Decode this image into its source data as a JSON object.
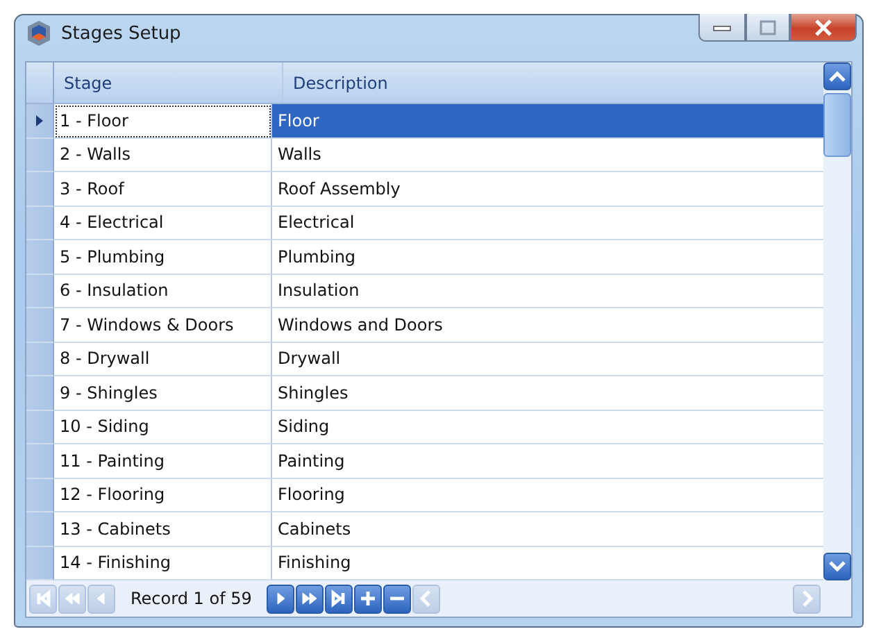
{
  "window": {
    "title": "Stages Setup"
  },
  "grid": {
    "columns": [
      "Stage",
      "Description"
    ],
    "rows": [
      {
        "stage": "1 - Floor",
        "description": "Floor",
        "selected": true
      },
      {
        "stage": "2 - Walls",
        "description": "Walls",
        "selected": false
      },
      {
        "stage": "3 - Roof",
        "description": "Roof Assembly",
        "selected": false
      },
      {
        "stage": "4 - Electrical",
        "description": "Electrical",
        "selected": false
      },
      {
        "stage": "5 - Plumbing",
        "description": "Plumbing",
        "selected": false
      },
      {
        "stage": "6 - Insulation",
        "description": "Insulation",
        "selected": false
      },
      {
        "stage": "7 - Windows & Doors",
        "description": "Windows and Doors",
        "selected": false
      },
      {
        "stage": "8 - Drywall",
        "description": "Drywall",
        "selected": false
      },
      {
        "stage": "9 - Shingles",
        "description": "Shingles",
        "selected": false
      },
      {
        "stage": "10 - Siding",
        "description": "Siding",
        "selected": false
      },
      {
        "stage": "11 - Painting",
        "description": "Painting",
        "selected": false
      },
      {
        "stage": "12 - Flooring",
        "description": "Flooring",
        "selected": false
      },
      {
        "stage": "13 - Cabinets",
        "description": "Cabinets",
        "selected": false
      },
      {
        "stage": "14 - Finishing",
        "description": "Finishing",
        "selected": false
      }
    ]
  },
  "navigator": {
    "record_text": "Record 1 of 59",
    "left_buttons": [
      {
        "kind": "first",
        "disabled": true
      },
      {
        "kind": "prev-page",
        "disabled": true
      },
      {
        "kind": "prev",
        "disabled": true
      }
    ],
    "right_buttons": [
      {
        "kind": "next",
        "disabled": false
      },
      {
        "kind": "next-page",
        "disabled": false
      },
      {
        "kind": "last",
        "disabled": false
      },
      {
        "kind": "add",
        "disabled": false
      },
      {
        "kind": "remove",
        "disabled": false
      },
      {
        "kind": "cancel",
        "disabled": true
      }
    ],
    "end_button": {
      "kind": "end",
      "disabled": true
    }
  }
}
